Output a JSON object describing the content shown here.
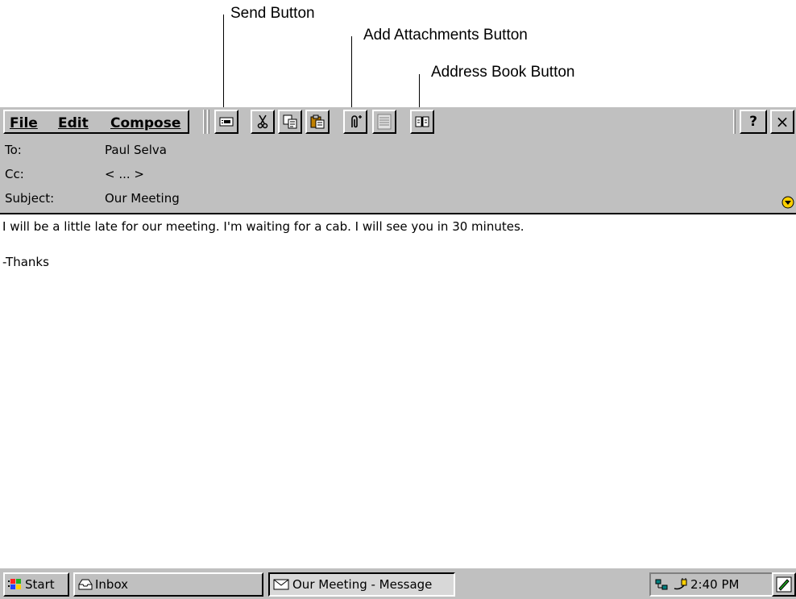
{
  "annotations": {
    "send": "Send Button",
    "attach": "Add Attachments Button",
    "address": "Address Book Button"
  },
  "menu": {
    "file": "File",
    "edit": "Edit",
    "compose": "Compose"
  },
  "toolbar": {
    "help": "?",
    "close": "×"
  },
  "header": {
    "to_label": "To:",
    "to_value": "Paul Selva",
    "cc_label": "Cc:",
    "cc_value": "< ... >",
    "subject_label": "Subject:",
    "subject_value": "Our Meeting"
  },
  "message": {
    "body": "I will be a little late for our meeting. I'm waiting for a cab. I will see you in 30 minutes.\n\n-Thanks"
  },
  "taskbar": {
    "start": "Start",
    "inbox": "Inbox",
    "active_window": "Our Meeting - Message",
    "clock": "2:40 PM"
  }
}
